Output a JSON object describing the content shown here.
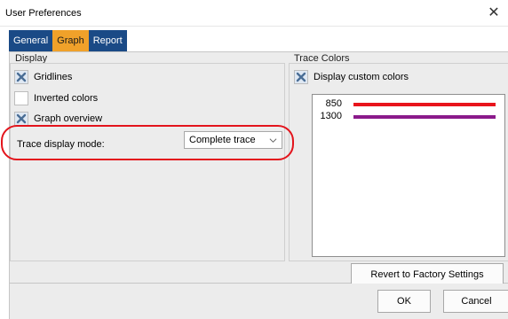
{
  "window": {
    "title": "User Preferences",
    "close_glyph": "✕"
  },
  "tabs": [
    {
      "label": "General",
      "active": false
    },
    {
      "label": "Graph",
      "active": true
    },
    {
      "label": "Report",
      "active": false
    }
  ],
  "display": {
    "title": "Display",
    "options": [
      {
        "label": "Gridlines",
        "checked": true
      },
      {
        "label": "Inverted colors",
        "checked": false
      },
      {
        "label": "Graph overview",
        "checked": true
      }
    ],
    "trace_mode_label": "Trace display mode:",
    "trace_mode_value": "Complete trace"
  },
  "trace_colors": {
    "title": "Trace Colors",
    "custom_label": "Display custom colors",
    "custom_checked": true,
    "traces": [
      {
        "wavelength": "850",
        "color": "#e8141c"
      },
      {
        "wavelength": "1300",
        "color": "#8b1a8b"
      }
    ]
  },
  "buttons": {
    "revert": "Revert to Factory Settings",
    "ok": "OK",
    "cancel": "Cancel"
  },
  "colors": {
    "tab_bg": "#1a4a86",
    "tab_active_bg": "#f0a12a",
    "highlight": "#e3141c",
    "check_mark": "#4a6e96"
  }
}
